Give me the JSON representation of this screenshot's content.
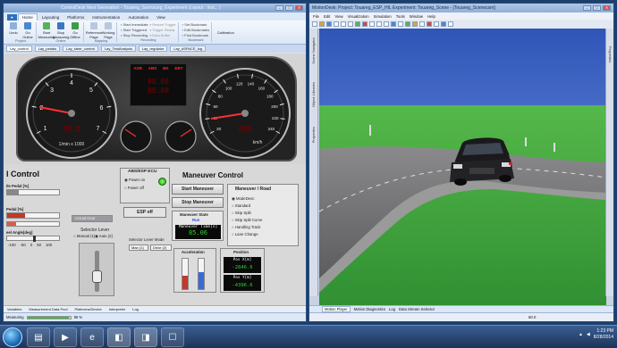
{
  "left_window": {
    "title": "ControlDesk Next Generation - Touareg_Sarmsung_Experiment (Layout : Inst... )",
    "ribbon_tabs": [
      "Home",
      "Layouting",
      "Platforms",
      "Instrumentation",
      "Automation",
      "View"
    ],
    "ribbon_active_tab": "Home",
    "ribbon_groups": {
      "project": {
        "name": "Project",
        "buttons": [
          "Undo",
          "Go Online"
        ]
      },
      "online": {
        "name": "Online",
        "buttons": [
          "Start Measuring",
          "Stop Measuring",
          "Go Offline"
        ]
      },
      "mapping": {
        "name": "Mapping",
        "buttons": [
          "Reference Page",
          "Working Page"
        ]
      },
      "recording": {
        "name": "Recording",
        "items": [
          "Start Immediate",
          "Start Triggered",
          "Stop Recording"
        ],
        "dim_items": [
          "Restart Trigger",
          "Trigger Ready",
          "Data Buffer"
        ]
      },
      "bookmarks": {
        "name": "Bookmark",
        "items": [
          "Set Bookmark",
          "Edit Bookmarks",
          "Find Bookmark"
        ]
      },
      "calibration": "Calibration"
    },
    "doc_tabs": [
      "Lay_control",
      "Lay_pedals",
      "Lay_steer_control",
      "Lay_TestAnalysis",
      "Lay_regulator",
      "Lay_dSPACE_log"
    ],
    "dash": {
      "warnings": [
        "ASR",
        "ABS",
        "BK",
        "EBT"
      ],
      "led_lines": [
        "88.88",
        "88:88"
      ],
      "rpm_unit": "1/min x 1000",
      "speed_unit": "km/h",
      "rpm_ticks": [
        "1",
        "2",
        "3",
        "4",
        "5",
        "6",
        "7"
      ],
      "speed_ticks": [
        "20",
        "40",
        "60",
        "80",
        "100",
        "120",
        "140",
        "160",
        "180",
        "200",
        "220",
        "240"
      ]
    },
    "controls": {
      "section_title": "l Control",
      "ecu_title": "ABS/ESP ECU",
      "power_on": "Power on",
      "power_off": "Power off",
      "esp_off": "ESP off",
      "maneuver_title": "Maneuver Control",
      "start_maneuver": "Start Maneuver",
      "stop_maneuver": "Stop Maneuver",
      "maneuver_state_label": "Maneuver State",
      "maneuver_state_value": "Run",
      "maneuver_time_label": "Maneuver Time[s]",
      "maneuver_time_value": "85.06",
      "maneuver_road_title": "Maneuver / Road",
      "road_options": [
        "ModeDesc",
        "Standard",
        "Skip Split",
        "Skip Split Curve",
        "Handling Track",
        "Lane Change"
      ],
      "acceleration_title": "Acceleration",
      "accel_scale": [
        "25",
        "15",
        "5",
        "0",
        "-5",
        "-15",
        "-25"
      ],
      "position_title": "Position",
      "pos_x_label": "Pos X[m]",
      "pos_x_value": "-2846.6",
      "pos_y_label": "Pos Y[m]",
      "pos_y_value": "-4396.6",
      "pedal1_label": "Ile Pedal [%]",
      "pedal2_label": "Pedal [%]",
      "steer_label": "eel Angle[deg]",
      "steer_scale": [
        "-100",
        "-50",
        "0",
        "50",
        "100"
      ],
      "auto_gear": "Actual Gear",
      "selector_lever": "Selector Lever",
      "manual_radio": "Manual (1)",
      "auto_radio": "Auto (2)",
      "selector_mode_label": "Selector Lever Mode",
      "mode_opts": [
        "Man (1)",
        "Drive (2)"
      ]
    },
    "bottom_tabs": [
      "Variables",
      "Measurement Data Pool",
      "Platforms/Device",
      "Interpreter",
      "Log"
    ],
    "status": {
      "measuring": "Measuring",
      "progress_pct": 96,
      "progress_label": "96 %"
    }
  },
  "right_window": {
    "title": "MotionDesk: Project: Touareg_ESP_HIL  Experiment: Touareg_Scene - [Touareg_Scenecam]",
    "menu": [
      "File",
      "Edit",
      "View",
      "Visualization",
      "Simulation",
      "Tools",
      "Window",
      "Help"
    ],
    "left_panels": [
      "Scene Navigator",
      "Object Libraries",
      "Properties"
    ],
    "right_panel": "Properties",
    "bottom_tabs": [
      "Motion Player",
      "Motion Diagnostics",
      "Log",
      "Data Stream Selector"
    ],
    "status_value": "60.0"
  },
  "taskbar": {
    "apps": [
      "folder",
      "media",
      "ie-browser",
      "controldesk",
      "motiondesk",
      "explorer"
    ],
    "clock_time": "1:23 PM",
    "clock_date": "8/28/2014"
  },
  "colors": {
    "ribbon_app": "#2f6fbe",
    "sky": "#4169c4",
    "grass": "#3da83d",
    "road": "#6d6d70",
    "digital": "#27d32a"
  }
}
